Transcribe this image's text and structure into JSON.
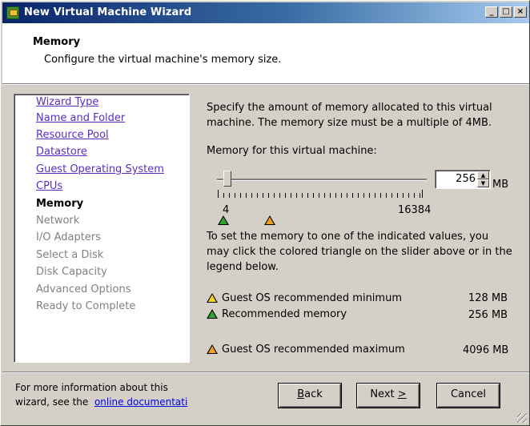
{
  "window": {
    "title": "New Virtual Machine Wizard",
    "controls": {
      "minimize": "_",
      "maximize": "□",
      "close": "×"
    }
  },
  "header": {
    "title": "Memory",
    "subtitle": "Configure the virtual machine's memory size."
  },
  "steps": [
    {
      "label": "Wizard Type",
      "state": "done"
    },
    {
      "label": "Name and Folder",
      "state": "done"
    },
    {
      "label": "Resource Pool",
      "state": "done"
    },
    {
      "label": "Datastore",
      "state": "done"
    },
    {
      "label": "Guest Operating System",
      "state": "done"
    },
    {
      "label": "CPUs",
      "state": "done"
    },
    {
      "label": "Memory",
      "state": "current"
    },
    {
      "label": "Network",
      "state": "future"
    },
    {
      "label": "I/O Adapters",
      "state": "future"
    },
    {
      "label": "Select a Disk",
      "state": "future"
    },
    {
      "label": "Disk Capacity",
      "state": "future"
    },
    {
      "label": "Advanced Options",
      "state": "future"
    },
    {
      "label": "Ready to Complete",
      "state": "future"
    }
  ],
  "content": {
    "intro_line1": "Specify the amount of memory allocated to this virtual",
    "intro_line2": "machine. The memory size must be a multiple of 4MB.",
    "memory_label": "Memory for this virtual machine:",
    "slider": {
      "min_label": "4",
      "max_label": "16384",
      "min": 4,
      "max": 16384,
      "value": 256
    },
    "spin_value": "256",
    "unit": "MB",
    "hint_line1": "To set the memory to one of the indicated values, you",
    "hint_line2": "may click the colored triangle on the slider above or in the",
    "hint_line3": "legend below.",
    "legend": [
      {
        "label": "Guest OS recommended minimum",
        "value": "128 MB",
        "color": "#f2d51c"
      },
      {
        "label": "Recommended memory",
        "value": "256 MB",
        "color": "#2fa52f"
      },
      {
        "label": "Guest OS recommended maximum",
        "value": "4096 MB",
        "color": "#f0a020"
      }
    ]
  },
  "footer": {
    "info_line1": "For more information about this",
    "info_line2_prefix": "wizard, see the",
    "info_link": "online documentati",
    "back_label": "Back",
    "back_mnemonic": "B",
    "next_label": "Next",
    "next_mnemonic": ">",
    "cancel_label": "Cancel"
  },
  "colors": {
    "titlebar_start": "#0a246a",
    "titlebar_end": "#a6caf0",
    "dialog_face": "#d4d0c8",
    "link_done": "#5b2ebf",
    "link_doc": "#0000ee"
  }
}
